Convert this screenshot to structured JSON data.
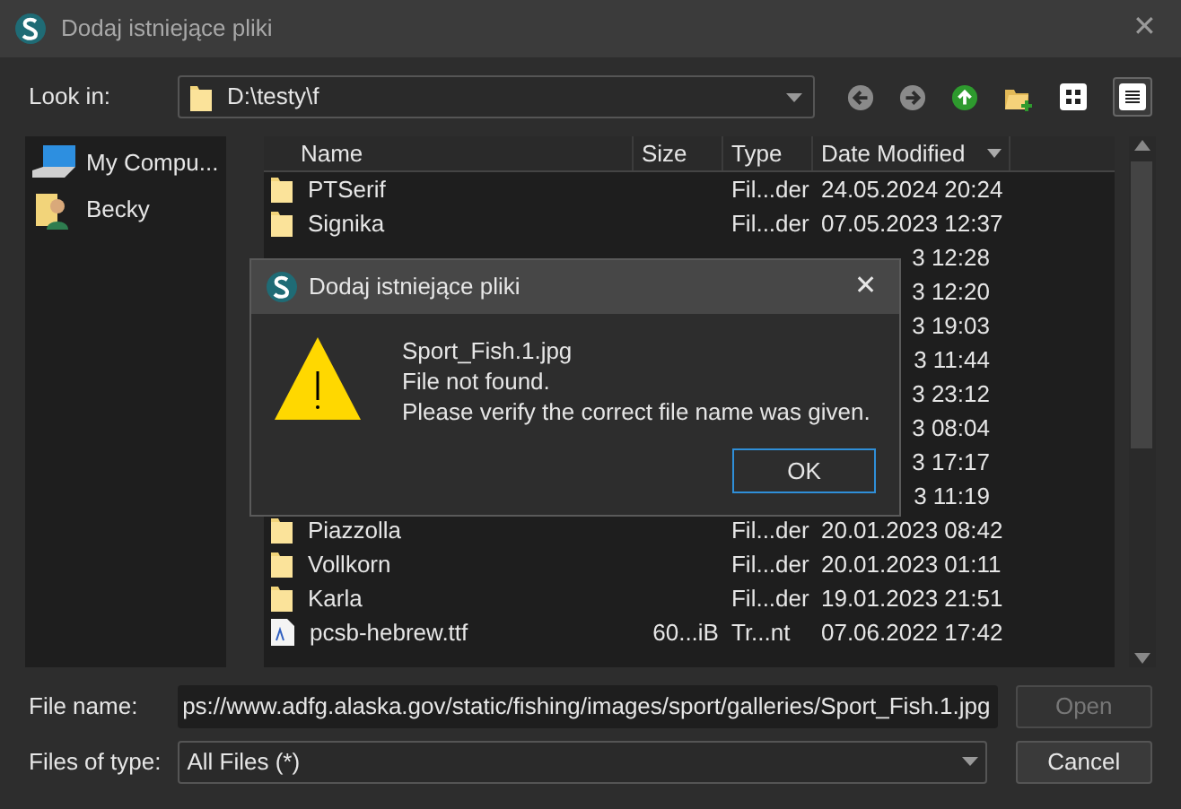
{
  "window": {
    "title": "Dodaj istniejące pliki",
    "close": "✕"
  },
  "look_in": {
    "label": "Look in:",
    "path": "D:\\testy\\f"
  },
  "sidebar": {
    "items": [
      {
        "label": "My Compu...",
        "kind": "computer",
        "selected": false
      },
      {
        "label": "Becky",
        "kind": "user",
        "selected": false
      }
    ]
  },
  "table": {
    "columns": [
      "Name",
      "Size",
      "Type",
      "Date Modified"
    ],
    "rows": [
      {
        "kind": "folder",
        "name": "PTSerif",
        "type": "Fil...der",
        "date": "24.05.2024 20:24"
      },
      {
        "kind": "folder",
        "name": "Signika",
        "type": "Fil...der",
        "date": "07.05.2023 12:37"
      },
      {
        "kind": "covered",
        "date": "3 12:28"
      },
      {
        "kind": "covered",
        "date": "3 12:20"
      },
      {
        "kind": "covered",
        "date": "3 19:03"
      },
      {
        "kind": "covered",
        "date": "3 11:44"
      },
      {
        "kind": "covered",
        "date": "3 23:12"
      },
      {
        "kind": "covered",
        "date": "3 08:04"
      },
      {
        "kind": "covered",
        "date": "3 17:17"
      },
      {
        "kind": "covered",
        "date": "3 11:19"
      },
      {
        "kind": "folder",
        "name": "Piazzolla",
        "type": "Fil...der",
        "date": "20.01.2023 08:42"
      },
      {
        "kind": "folder",
        "name": "Vollkorn",
        "type": "Fil...der",
        "date": "20.01.2023 01:11"
      },
      {
        "kind": "folder",
        "name": "Karla",
        "type": "Fil...der",
        "date": "19.01.2023 21:51"
      },
      {
        "kind": "file",
        "name": "pcsb-hebrew.ttf",
        "size": "60...iB",
        "type": "Tr...nt",
        "date": "07.06.2022 17:42"
      }
    ]
  },
  "file_name": {
    "label": "File name:",
    "value": "ps://www.adfg.alaska.gov/static/fishing/images/sport/galleries/Sport_Fish.1.jpg"
  },
  "files_of_type": {
    "label": "Files of type:",
    "value": "All Files (*)"
  },
  "buttons": [
    {
      "label": "Open",
      "disabled": true
    },
    {
      "label": "Cancel",
      "disabled": false
    }
  ],
  "message_box": {
    "title": "Dodaj istniejące pliki",
    "close": "✕",
    "lines": [
      "Sport_Fish.1.jpg",
      "File not found.",
      "Please verify the correct file name was given."
    ],
    "button": "OK"
  }
}
